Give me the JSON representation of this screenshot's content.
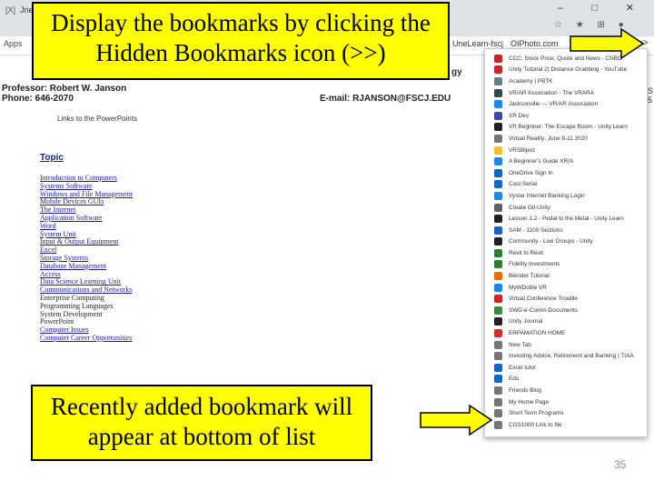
{
  "browser": {
    "tab_icon": "[X]",
    "tab_label": "Jne",
    "window_controls": "– □ ✕",
    "toolbar_icons": "☆ ★ ⊞ ●",
    "apps_label": "Apps",
    "bookmarks": [
      "UneLearn-fscj",
      "OIPhoto.com"
    ],
    "overflow_icon": ">>"
  },
  "callouts": {
    "top": "Display the bookmarks by clicking the  Hidden Bookmarks icon (>>)",
    "bottom": "Recently added bookmark will appear at bottom of list"
  },
  "page": {
    "professor": "Professor: Robert W. Janson",
    "phone": "Phone: 646-2070",
    "email": "E-mail: RJANSON@FSCJ.EDU",
    "links_heading": "Links to the PowerPoints",
    "topic_heading": "Topic",
    "topics": [
      "Introduction to Computers",
      "Systems Software",
      "Windows and File Management",
      "Mobile Devices GUIs",
      "The Internet",
      "Application Software",
      "Word",
      "System Unit",
      "Input & Output Equipment",
      "Excel",
      "Storage Systems",
      "Database Management",
      "Access",
      "Data Science Learning Unit",
      "Communications and Networks",
      "Enterprise Computing",
      "Programming Languages",
      "System Development",
      "PowerPoint",
      "Computer Issues",
      "Computer Career Opportunities"
    ],
    "right_fragment": "gy",
    "edge_chars": [
      "S",
      "5"
    ]
  },
  "dropdown": {
    "items": [
      {
        "label": "CCC: Stock Price, Quote and News - CNBC",
        "icon_color": "#c62828"
      },
      {
        "label": "Unity Tutorial 2) Distance Grabbing - YouTube",
        "icon_color": "#c62828"
      },
      {
        "label": "Academy | PBTK",
        "icon_color": "#607d8b"
      },
      {
        "label": "VR/AR Association - The VRARA",
        "icon_color": "#37474f"
      },
      {
        "label": "Jacksonville — VR/AR Association",
        "icon_color": "#1e88e5"
      },
      {
        "label": "XR Dev",
        "icon_color": "#3949ab"
      },
      {
        "label": "VR Beginner: The Escape Room - Unity Learn",
        "icon_color": "#212121"
      },
      {
        "label": "Virtual Reality: June 8-11 2020",
        "icon_color": "#757575"
      },
      {
        "label": "VRSBiject",
        "icon_color": "#fbc02d"
      },
      {
        "label": "A Beginner's Guide XR/A",
        "icon_color": "#1e88e5"
      },
      {
        "label": "OneDrive Sign In",
        "icon_color": "#1565c0"
      },
      {
        "label": "Cool Serial",
        "icon_color": "#1565c0"
      },
      {
        "label": "Vystar Internet Banking Login",
        "icon_color": "#1e88e5"
      },
      {
        "label": "Create Git-Unity",
        "icon_color": "#616161"
      },
      {
        "label": "Lesson 1.2 - Pedal to the Metal - Unity Learn",
        "icon_color": "#212121"
      },
      {
        "label": "SAM - 1100 Sections",
        "icon_color": "#1565c0"
      },
      {
        "label": "Community - Live Groups - Unity",
        "icon_color": "#212121"
      },
      {
        "label": "Revit to Revit",
        "icon_color": "#2e7d32"
      },
      {
        "label": "Fidelity Investments",
        "icon_color": "#2e7d32"
      },
      {
        "label": "Blender Tutorial",
        "icon_color": "#ef6c00"
      },
      {
        "label": "MyWDoble VR",
        "icon_color": "#1e88e5"
      },
      {
        "label": "Virtual Conference Trouble",
        "icon_color": "#c62828"
      },
      {
        "label": "SWD-e-Comm-Documents",
        "icon_color": "#388e3c"
      },
      {
        "label": "Unity Journal",
        "icon_color": "#212121"
      },
      {
        "label": "ERPAMATION HOME",
        "icon_color": "#d32f2f"
      },
      {
        "label": "New Tab",
        "icon_color": "#757575"
      },
      {
        "label": "Investing Advice, Retirement and Banking | TIAA",
        "icon_color": "#757575"
      },
      {
        "label": "Excel tutor",
        "icon_color": "#1565c0"
      },
      {
        "label": "Edu",
        "icon_color": "#1565c0"
      },
      {
        "label": "Friends Blog",
        "icon_color": "#757575"
      },
      {
        "label": "My Home Page",
        "icon_color": "#757575"
      },
      {
        "label": "Short Term Programs",
        "icon_color": "#757575"
      },
      {
        "label": "CGS1000 Link to file",
        "icon_color": "#757575"
      }
    ]
  },
  "slide": {
    "page_number": "35"
  },
  "colors": {
    "callout": "#ffff00",
    "arrow": "#ffff00",
    "page_number": "#7b8fb5"
  }
}
